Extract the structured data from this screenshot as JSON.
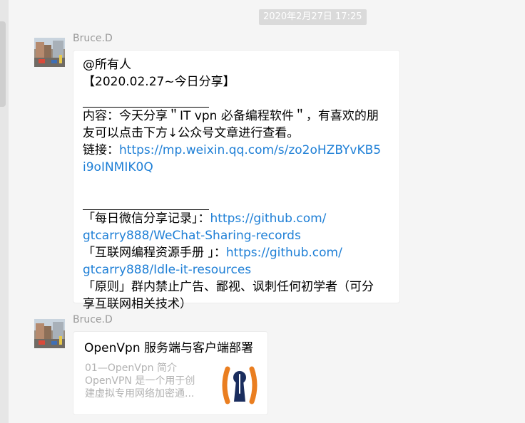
{
  "chat": {
    "timestamp": "2020年2月27日 17:25"
  },
  "messages": [
    {
      "sender": "Bruce.D",
      "lines": {
        "l1": "@所有人",
        "l2": "【2020.02.27~今日分享】",
        "l4": "内容：今天分享＂IT vpn 必备编程软件＂，有喜欢的朋",
        "l5": "友可以点击下方↓公众号文章进行查看。",
        "l6_label": "链接：",
        "l6_link": "https://mp.weixin.qq.com/s/zo2oHZBYvKB5",
        "l7_link": "i9oINMIK0Q",
        "l10_label": "「每日微信分享记录」：",
        "l10_link": "https://github.com/",
        "l11_link": "gtcarry888/WeChat-Sharing-records",
        "l12_label": "「互联网编程资源手册 」：",
        "l12_link": "https://github.com/",
        "l13_link": "gtcarry888/Idle-it-resources",
        "l14": "「原则」群内禁止广告、鄙视、讽刺任何初学者（可分",
        "l15": "享互联网相关技术）"
      }
    },
    {
      "sender": "Bruce.D",
      "card": {
        "title": "OpenVpn 服务端与客户端部署",
        "desc_line1": "01—OpenVpn 简介",
        "desc_line2": "OpenVPN 是一个用于创",
        "desc_line3": "建虚拟专用网络加密通...",
        "thumbnail_icon": "openvpn-logo-icon"
      }
    }
  ],
  "colors": {
    "link": "#1e7fd6",
    "background": "#f5f5f5",
    "timestamp_bg": "#dadada",
    "openvpn_orange": "#ea7e20",
    "openvpn_navy": "#1a2d5e"
  }
}
